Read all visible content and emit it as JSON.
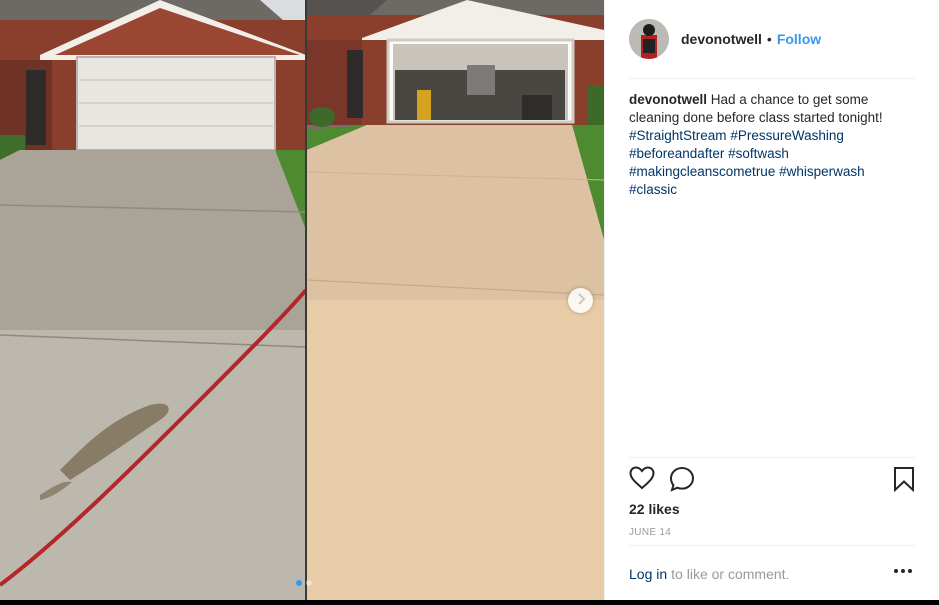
{
  "post": {
    "author": "devonotwell",
    "follow_separator": "•",
    "follow_label": "Follow"
  },
  "caption": {
    "username": "devonotwell",
    "text": "Had a chance to get some cleaning done before class started tonight!",
    "hashtags": [
      "#StraightStream",
      "#PressureWashing",
      "#beforeandafter",
      "#softwash",
      "#makingcleanscometrue",
      "#whisperwash",
      "#classic"
    ]
  },
  "engagement": {
    "likes": "22 likes",
    "date": "June 14"
  },
  "footer": {
    "login_label": "Log in",
    "login_rest": "to like or comment."
  },
  "carousel": {
    "slide_count": 2,
    "active_slide": 1
  },
  "icons": {
    "like": "heart-icon",
    "comment": "comment-icon",
    "save": "bookmark-icon",
    "next": "chevron-right-icon",
    "more": "more-options-icon"
  },
  "colors": {
    "link_blue": "#3897f0",
    "hashtag_blue": "#003569",
    "text": "#262626",
    "muted": "#999999",
    "border": "#efefef"
  }
}
